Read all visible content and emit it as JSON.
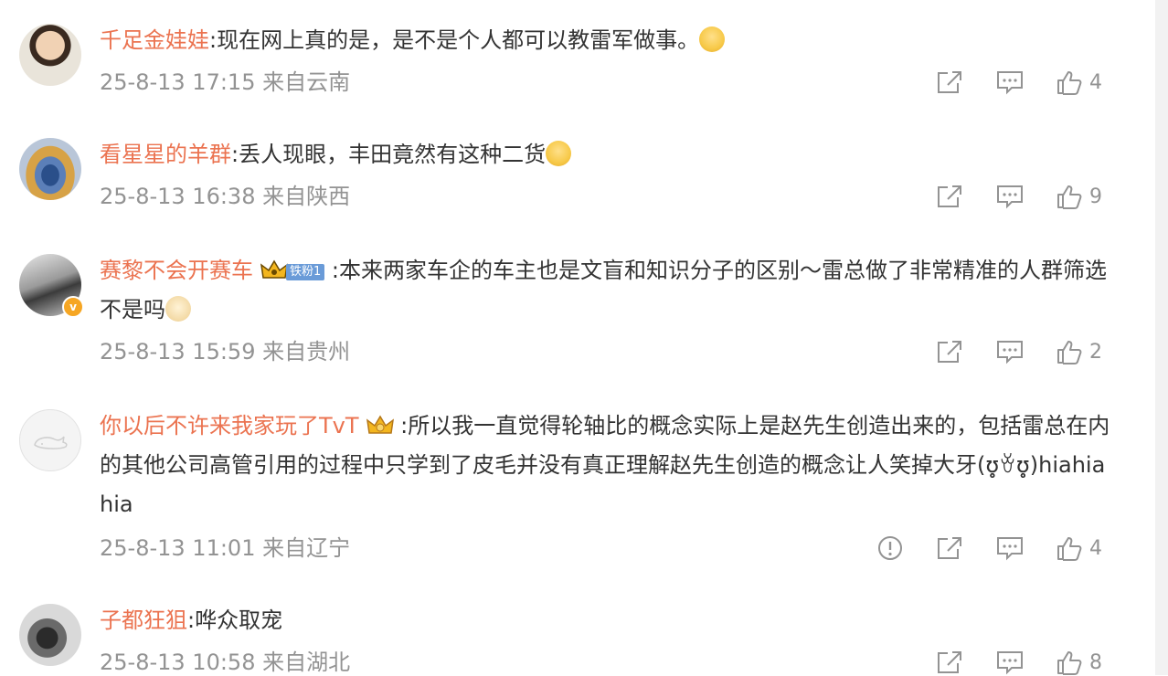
{
  "comments": [
    {
      "username": "千足金娃娃",
      "text": ":现在网上真的是，是不是个人都可以教雷军做事。",
      "emoji": "laugh-cry-emoji",
      "time": "25-8-13 17:15",
      "location": "来自云南",
      "likes": "4",
      "report": false
    },
    {
      "username": "看星星的羊群",
      "text": ":丢人现眼，丰田竟然有这种二货",
      "emoji": "laugh-cry-emoji",
      "time": "25-8-13 16:38",
      "location": "来自陕西",
      "likes": "9",
      "report": false
    },
    {
      "username": "赛黎不会开赛车",
      "fan_badge": "铁粉1",
      "text": ":本来两家车企的车主也是文盲和知识分子的区别～雷总做了非常精准的人群筛选不是吗",
      "emoji": "doge-emoji",
      "time": "25-8-13 15:59",
      "location": "来自贵州",
      "likes": "2",
      "report": false
    },
    {
      "username": "你以后不许来我家玩了TvT",
      "text": ":所以我一直觉得轮轴比的概念实际上是赵先生创造出来的，包括雷总在内的其他公司高管引用的过程中只学到了皮毛并没有真正理解赵先生创造的概念让人笑掉大牙(ʊ̥̥̥̥ꈊʊ̥̥̥̥)hiahiahia",
      "time": "25-8-13 11:01",
      "location": "来自辽宁",
      "likes": "4",
      "report": true
    },
    {
      "username": "子都狂狙",
      "text": ":哗众取宠",
      "time": "25-8-13 10:58",
      "location": "来自湖北",
      "likes": "8",
      "report": false
    }
  ]
}
